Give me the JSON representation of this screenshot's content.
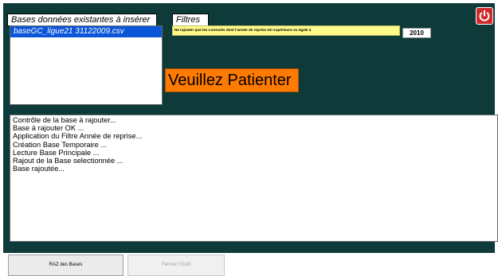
{
  "bases_panel": {
    "caption": "Bases données existantes à insérer",
    "items": [
      {
        "label": "baseGC_ligue21 31122009.csv",
        "selected": true
      }
    ]
  },
  "filters_panel": {
    "caption": "Filtres",
    "rule_label": "Ne rajouter que les Licenciés dont l'année de reprise est supérieure ou égale à",
    "year_value": "2010"
  },
  "status": {
    "message": "Veuillez Patienter"
  },
  "log": {
    "lines": [
      "Contrôle de la base à rajouter...",
      "Base à rajouter OK ...",
      "Application du Filtre Année de reprise...",
      "Création Base Temporaire ...",
      "Lecture Base Principale ...",
      "Rajout de la Base selectionnée ...",
      "Base rajoutée..."
    ]
  },
  "buttons": {
    "raz_label": "RAZ des Bases",
    "fermer_label": "Fermer l'Outil"
  },
  "icons": {
    "power": "power-icon"
  },
  "colors": {
    "panel_bg": "#0e3b3a",
    "selection": "#0a55d8",
    "filter_bg": "#fffb8a",
    "status_bg": "#ff7a00",
    "power_button": "#d12a2a"
  }
}
